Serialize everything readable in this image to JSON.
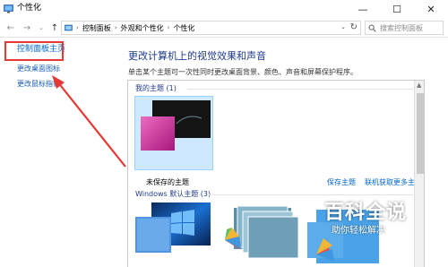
{
  "window": {
    "title": "个性化",
    "controls": {
      "minimize": "—",
      "maximize": "☐",
      "close": "✕"
    }
  },
  "address_bar": {
    "breadcrumbs": [
      "控制面板",
      "外观和个性化",
      "个性化"
    ],
    "separator": "›",
    "dropdown": "⌄",
    "refresh": "↻"
  },
  "search": {
    "placeholder": "搜索控制面板"
  },
  "left_pane": {
    "home_link": "控制面板主页",
    "tasks": [
      "更改桌面图标",
      "更改鼠标指针"
    ]
  },
  "main": {
    "title": "更改计算机上的视觉效果和声音",
    "description": "单击某个主题可一次性同时更改桌面背景、颜色、声音和屏幕保护程序。",
    "my_themes": {
      "heading": "我的主题 (1)",
      "selected_theme": "未保存的主题",
      "actions": [
        "保存主题",
        "联机获取更多主题"
      ]
    },
    "windows_themes": {
      "heading": "Windows 默认主题 (3)"
    }
  },
  "watermark": {
    "brand": "百科全说",
    "slogan": "助你轻松解决"
  },
  "colors": {
    "accent": "#0066cc",
    "title_blue": "#1e3a8a",
    "selection": "#cde8ff",
    "highlight_red": "#e53935"
  },
  "icons": {
    "app": "personalization-icon",
    "location": "control-panel-icon",
    "search": "search-icon"
  }
}
